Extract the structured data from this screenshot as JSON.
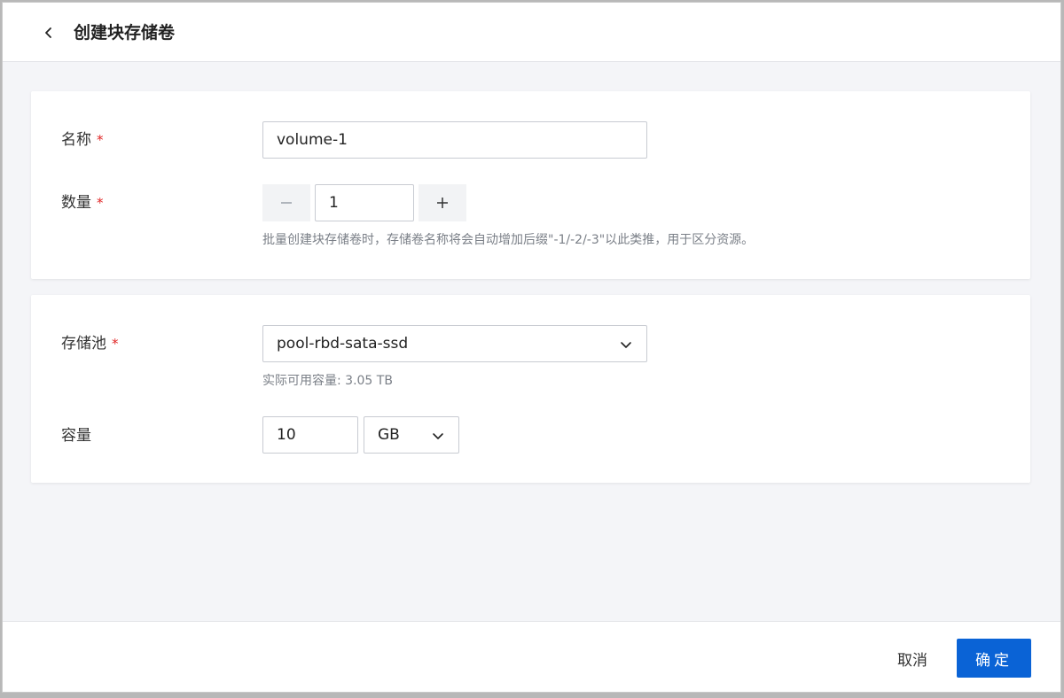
{
  "header": {
    "title": "创建块存储卷",
    "back_icon": "chevron-left-icon"
  },
  "form": {
    "name": {
      "label": "名称",
      "required_mark": "*",
      "value": "volume-1"
    },
    "quantity": {
      "label": "数量",
      "required_mark": "*",
      "value": "1",
      "hint": "批量创建块存储卷时，存储卷名称将会自动增加后缀\"-1/-2/-3\"以此类推，用于区分资源。"
    },
    "pool": {
      "label": "存储池",
      "required_mark": "*",
      "selected": "pool-rbd-sata-ssd",
      "hint": "实际可用容量: 3.05 TB"
    },
    "capacity": {
      "label": "容量",
      "value": "10",
      "unit_selected": "GB"
    }
  },
  "footer": {
    "cancel_label": "取消",
    "confirm_label": "确定"
  },
  "colors": {
    "primary": "#0a63d6",
    "required": "#e02424",
    "background": "#f4f5f8"
  }
}
